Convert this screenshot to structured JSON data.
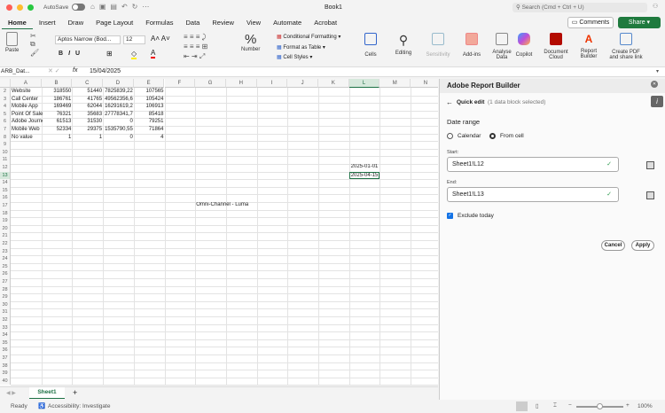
{
  "title": "Book1",
  "autosave": "AutoSave",
  "search_placeholder": "Search (Cmd + Ctrl + U)",
  "comments": "Comments",
  "share": "Share",
  "tabs": [
    "Home",
    "Insert",
    "Draw",
    "Page Layout",
    "Formulas",
    "Data",
    "Review",
    "View",
    "Automate",
    "Acrobat"
  ],
  "ribbon": {
    "paste": "Paste",
    "font": "Aptos Narrow (Bod...",
    "size": "12",
    "number": "Number",
    "cond_format": "Conditional Formatting",
    "format_table": "Format as Table",
    "cell_styles": "Cell Styles",
    "cells": "Cells",
    "editing": "Editing",
    "sensitivity": "Sensitivity",
    "addins": "Add-ins",
    "analyse": "Analyse Data",
    "copilot": "Copilot",
    "doc_cloud": "Document Cloud",
    "report_builder": "Report Builder",
    "create_pdf": "Create PDF and share link"
  },
  "formula": {
    "name_box": "ARB_Dat...",
    "fx": "fx",
    "value": "15/04/2025"
  },
  "columns": [
    "A",
    "B",
    "C",
    "D",
    "E",
    "F",
    "G",
    "H",
    "I",
    "J",
    "K",
    "L",
    "M",
    "N"
  ],
  "first_row": 2,
  "last_row": 40,
  "rows": [
    [
      "Website",
      "318550",
      "51440",
      "7825839,22",
      "107565"
    ],
    [
      "Call Center",
      "186761",
      "41765",
      "49562356,6",
      "105424"
    ],
    [
      "Mobile App",
      "169469",
      "62044",
      "16291619,2",
      "106913"
    ],
    [
      "Point Of Sale",
      "76321",
      "35683",
      "27778341,7",
      "85418"
    ],
    [
      "Adobe Journe",
      "61513",
      "31530",
      "0",
      "79251"
    ],
    [
      "Mobile Web",
      "52334",
      "29375",
      "1535790,55",
      "71864"
    ],
    [
      "No value",
      "1",
      "1",
      "0",
      "4"
    ]
  ],
  "extra_cells": {
    "L12": "2025-01-01",
    "L13": "2025-04-15",
    "G17": "Omni-Channel - Luma"
  },
  "sheet_tab": "Sheet1",
  "panel": {
    "title": "Adobe Report Builder",
    "quick_edit": "Quick edit",
    "selected": "(1 data block selected)",
    "date_range": "Date range",
    "calendar": "Calendar",
    "from_cell": "From cell",
    "start_label": "Start:",
    "start_value": "Sheet1!L12",
    "end_label": "End:",
    "end_value": "Sheet1!L13",
    "exclude_today": "Exclude today",
    "cancel": "Cancel",
    "apply": "Apply"
  },
  "status": {
    "ready": "Ready",
    "accessibility": "Accessibility: Investigate",
    "zoom": "100%"
  },
  "colors": {
    "accent": "#1e7145",
    "share": "#1f7a3e",
    "check": "#2e9b4f",
    "checkbox": "#1473e6"
  }
}
